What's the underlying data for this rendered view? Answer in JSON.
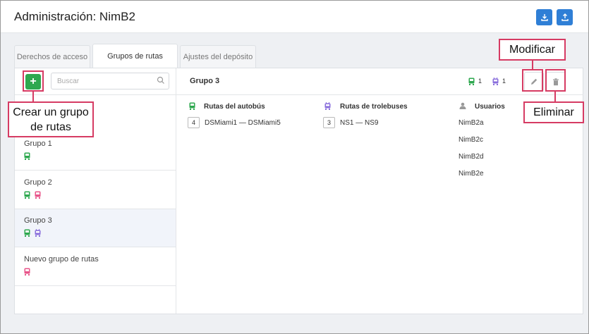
{
  "header": {
    "title": "Administración: NimB2"
  },
  "tabs": [
    {
      "label": "Derechos de acceso"
    },
    {
      "label": "Grupos de rutas"
    },
    {
      "label": "Ajustes del depósito"
    }
  ],
  "search": {
    "placeholder": "Buscar"
  },
  "groups": [
    {
      "name": "Grupo 1"
    },
    {
      "name": "Grupo 2"
    },
    {
      "name": "Grupo 3"
    },
    {
      "name": "Nuevo grupo de rutas"
    }
  ],
  "detail": {
    "title": "Grupo 3",
    "bus_count": "1",
    "trolley_count": "1",
    "bus_header": "Rutas del autobús",
    "trolley_header": "Rutas de trolebuses",
    "users_header": "Usuarios",
    "bus_routes": [
      {
        "count": "4",
        "name": "DSMiami1 — DSMiami5"
      }
    ],
    "trolley_routes": [
      {
        "count": "3",
        "name": "NS1 — NS9"
      }
    ],
    "users": [
      "NimB2a",
      "NimB2c",
      "NimB2d",
      "NimB2e"
    ]
  },
  "callouts": {
    "modify": "Modificar",
    "delete": "Eliminar",
    "create": "Crear un grupo de rutas"
  },
  "colors": {
    "bus": "#2ea84f",
    "trolley": "#8a6fdc",
    "alt_bus": "#e8558a",
    "primary": "#2f7fd6",
    "callout": "#d63b63"
  }
}
